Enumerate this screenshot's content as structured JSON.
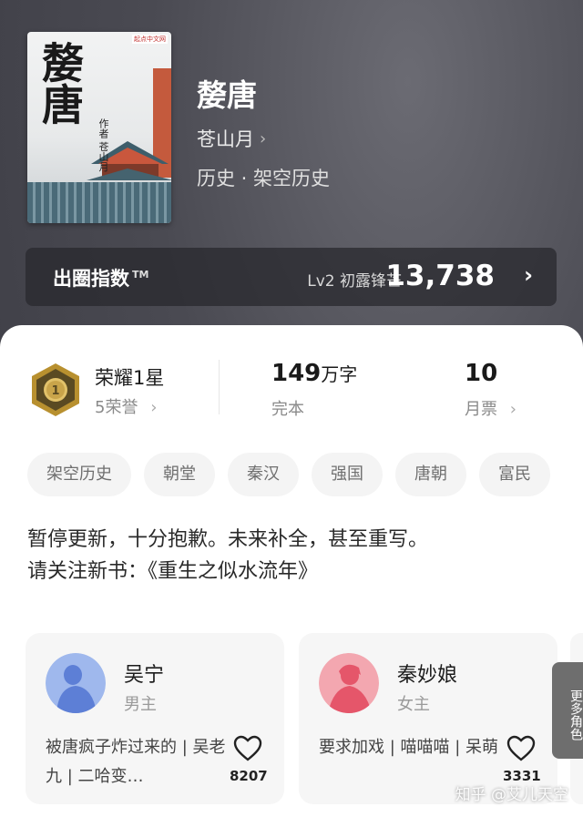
{
  "book": {
    "title": "嫠唐",
    "author": "苍山月",
    "genre": "历史 · 架空历史",
    "cover": {
      "publisher_badge": "起点中文网",
      "title": "嫠唐",
      "author_line": "作者 苍山月"
    }
  },
  "rank": {
    "label": "出圈指数",
    "tm": "TM",
    "level": "Lv2 初露锋芒",
    "score": "13,738"
  },
  "stats": {
    "honor_title": "荣耀1星",
    "honor_sub": "5荣誉",
    "honor_badge_number": "1",
    "words_num": "149",
    "words_unit": "万字",
    "words_status": "完本",
    "tickets_num": "10",
    "tickets_label": "月票"
  },
  "tags": [
    "架空历史",
    "朝堂",
    "秦汉",
    "强国",
    "唐朝",
    "富民"
  ],
  "notice": {
    "line1": "暂停更新，十分抱歉。未来补全，甚至重写。",
    "line2": "请关注新书：《重生之似水流年》"
  },
  "characters": [
    {
      "name": "吴宁",
      "role": "男主",
      "desc": "被唐疯子炸过来的 | 吴老九 | 二哈变…",
      "likes": "8207",
      "color": "#6f93e0"
    },
    {
      "name": "秦妙娘",
      "role": "女主",
      "desc": "要求加戏 | 喵喵喵 | 呆萌",
      "likes": "3331",
      "color": "#ec6b7a"
    }
  ],
  "more_roles": "更多角色",
  "watermark": "知乎 @艾儿天空",
  "colors": {
    "accent_text": "#1c1c1c",
    "secondary_text": "#8a8a8a",
    "tag_bg": "#f4f4f4"
  }
}
